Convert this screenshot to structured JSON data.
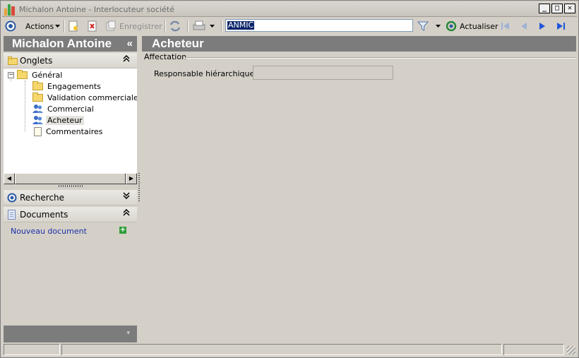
{
  "window": {
    "title": "Michalon Antoine -  Interlocuteur société",
    "controls": {
      "minimize": "_",
      "maximize": "□",
      "close": "✕"
    }
  },
  "toolbar": {
    "actions_label": "Actions",
    "save_label": "Enregistrer",
    "search_value": "ANMIC",
    "refresh_label": "Actualiser"
  },
  "left_panel": {
    "header_title": "Michalon Antoine",
    "collapse_glyph": "«",
    "tabs_section": {
      "label": "Onglets",
      "chevron": "⌃"
    },
    "tree": {
      "root": "Général",
      "items": [
        {
          "label": "Engagements",
          "icon": "folder-icon"
        },
        {
          "label": "Validation commerciale / BAT",
          "icon": "folder-icon"
        },
        {
          "label": "Commercial",
          "icon": "users-icon"
        },
        {
          "label": "Acheteur",
          "icon": "users-icon",
          "selected": true
        },
        {
          "label": "Commentaires",
          "icon": "note-icon"
        }
      ]
    },
    "search_section": {
      "label": "Recherche",
      "chevron": "⌄"
    },
    "documents_section": {
      "label": "Documents",
      "chevron": "⌃"
    },
    "new_document_link": "Nouveau document",
    "footer_chevron": "▾"
  },
  "main": {
    "title": "Acheteur",
    "group_label": "Affectation",
    "fields": [
      {
        "label": "Responsable hiérarchique :",
        "value": ""
      }
    ]
  },
  "colors": {
    "header_bg": "#7c7c7c",
    "panel_bg": "#d4d0c8",
    "link": "#1c2fa8",
    "selection": "#0a246a"
  }
}
